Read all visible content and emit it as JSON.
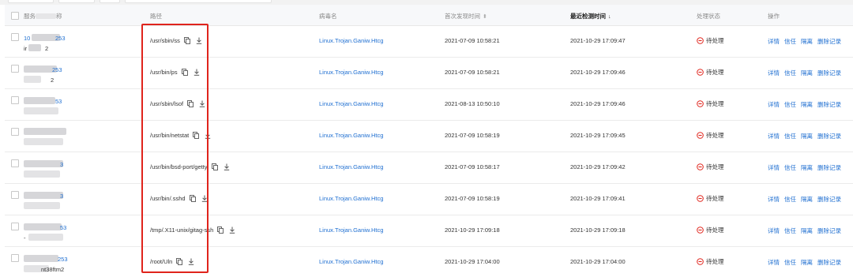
{
  "colors": {
    "link": "#1f6fd1",
    "status_icon": "#e0241c",
    "highlight_box": "#e0241c",
    "header_bg": "#f7f8fa"
  },
  "header": {
    "server": "服务",
    "server_tail": "称",
    "path": "路径",
    "virus": "病毒名",
    "first_seen": "首次发现时间",
    "last_detected": "最近检测时间",
    "status": "处理状态",
    "actions": "操作",
    "sort_both_icon": "sort-both-icon",
    "sort_down_icon": "sort-desc-icon"
  },
  "rows": [
    {
      "server_ip": "10",
      "server_ip_tail": "253",
      "server_name": "ir",
      "server_name_tail": "2",
      "path": "/usr/sbin/ss",
      "virus": "Linux.Trojan.Ganiw.Htcg",
      "first_seen": "2021-07-09 10:58:21",
      "last_detected": "2021-10-29 17:09:47",
      "status": "待处理"
    },
    {
      "server_ip": "",
      "server_ip_tail": "253",
      "server_name": "",
      "server_name_tail": "2",
      "path": "/usr/bin/ps",
      "virus": "Linux.Trojan.Ganiw.Htcg",
      "first_seen": "2021-07-09 10:58:21",
      "last_detected": "2021-10-29 17:09:46",
      "status": "待处理"
    },
    {
      "server_ip": "",
      "server_ip_tail": "53",
      "server_name": "",
      "server_name_tail": "",
      "path": "/usr/sbin/lsof",
      "virus": "Linux.Trojan.Ganiw.Htcg",
      "first_seen": "2021-08-13 10:50:10",
      "last_detected": "2021-10-29 17:09:46",
      "status": "待处理"
    },
    {
      "server_ip": "",
      "server_ip_tail": "",
      "server_name": "",
      "server_name_tail": "",
      "path": "/usr/bin/netstat",
      "virus": "Linux.Trojan.Ganiw.Htcg",
      "first_seen": "2021-07-09 10:58:19",
      "last_detected": "2021-10-29 17:09:45",
      "status": "待处理"
    },
    {
      "server_ip": "",
      "server_ip_tail": "3",
      "server_name": "",
      "server_name_tail": "",
      "path": "/usr/bin/bsd-port/getty",
      "virus": "Linux.Trojan.Ganiw.Htcg",
      "first_seen": "2021-07-09 10:58:17",
      "last_detected": "2021-10-29 17:09:42",
      "status": "待处理"
    },
    {
      "server_ip": "",
      "server_ip_tail": "3",
      "server_name": "",
      "server_name_tail": "",
      "path": "/usr/bin/.sshd",
      "virus": "Linux.Trojan.Ganiw.Htcg",
      "first_seen": "2021-07-09 10:58:19",
      "last_detected": "2021-10-29 17:09:41",
      "status": "待处理"
    },
    {
      "server_ip": "",
      "server_ip_tail": "53",
      "server_name": "-",
      "server_name_tail": "",
      "path": "/tmp/.X11-unix/gitag-ssh",
      "virus": "Linux.Trojan.Ganiw.Htcg",
      "first_seen": "2021-10-29 17:09:18",
      "last_detected": "2021-10-29 17:09:18",
      "status": "待处理"
    },
    {
      "server_ip": "",
      "server_ip_tail": "253",
      "server_name": "",
      "server_name_tail": "nt38ftm2",
      "path": "/root/Uln",
      "virus": "Linux.Trojan.Ganiw.Htcg",
      "first_seen": "2021-10-29 17:04:00",
      "last_detected": "2021-10-29 17:04:00",
      "status": "待处理"
    }
  ],
  "row_actions": {
    "detail": "详情",
    "trust": "信任",
    "isolate": "隔离",
    "delete": "删除记录"
  },
  "icons": {
    "copy": "copy-icon",
    "download": "download-icon",
    "status": "minus-circle-icon"
  }
}
